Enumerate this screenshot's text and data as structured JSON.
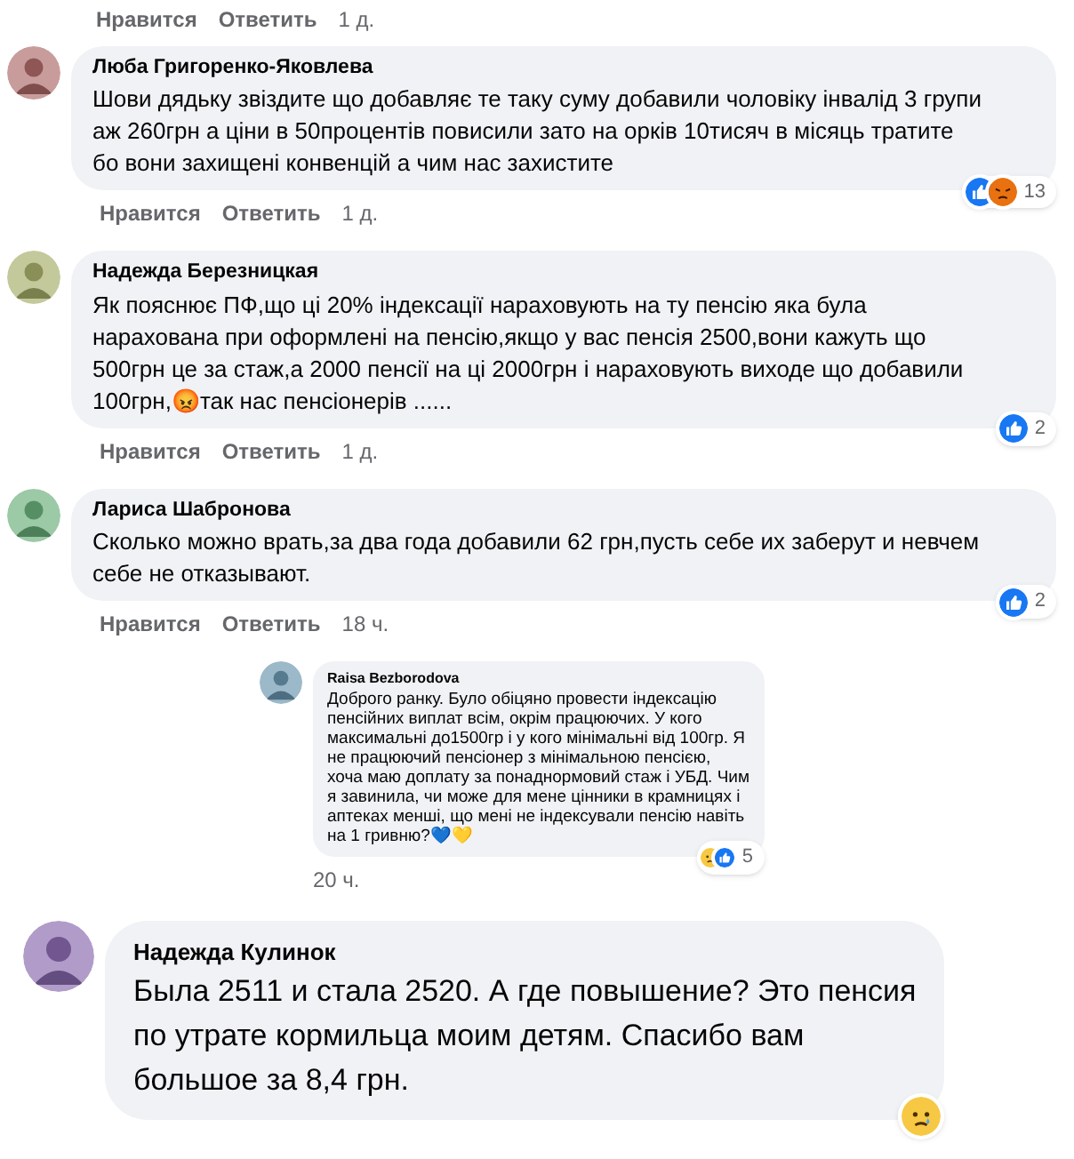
{
  "top_actions": {
    "like": "Нравится",
    "reply": "Ответить",
    "time": "1 д."
  },
  "comments": [
    {
      "kind": "normal",
      "author": "Люба Григоренко-Яковлева",
      "text": "Шови дядьку звіздите що добавляє те таку суму добавили чоловіку інвалід 3 групи\nаж 260грн а ціни в 50процентів повисили зато на орків 10тисяч в місяць тратите\nбо вони захищені конвенцій а чим нас захистите",
      "reactions": [
        {
          "kind": "like"
        },
        {
          "kind": "angry"
        }
      ],
      "count": "13",
      "like": "Нравится",
      "reply": "Ответить",
      "time": "1 д."
    },
    {
      "kind": "normal",
      "author": "Надежда Березницкая",
      "text": "Як пояснює ПФ,що ці 20% індексації нараховують на ту пенсію яка була\nнарахована при оформлені на пенсію,якщо у вас пенсія 2500,вони кажуть що\n500грн це за стаж,а 2000 пенсії на ці 2000грн і нараховують виходе що добавили\n100грн,😡так нас пенсіонерів ......",
      "reactions": [
        {
          "kind": "like"
        }
      ],
      "count": "2",
      "like": "Нравится",
      "reply": "Ответить",
      "time": "1 д."
    },
    {
      "kind": "normal",
      "author": "Лариса Шабронова",
      "text": "Сколько можно врать,за два года добавили 62 грн,пусть себе их заберут и невчем\nсебе не отказывают.",
      "reactions": [
        {
          "kind": "like"
        }
      ],
      "count": "2",
      "like": "Нравится",
      "reply": "Ответить",
      "time": "18 ч."
    },
    {
      "kind": "small",
      "author": "Raisa Bezborodova",
      "text": "Доброго ранку. Було обіцяно провести індексацію\nпенсійних виплат всім, окрім працюючих. У кого\nмаксимальні до1500гр і у кого мінімальні від 100гр. Я\nне працюючий пенсіонер з мінімальною пенсією,\nхоча маю доплату за понаднормовий стаж і УБД. Чим\nя завинила, чи може для мене цінники в крамницях і\nаптеках менші, що мені не індексували пенсію навіть\nна 1 гривню?💙💛",
      "reactions": [
        {
          "kind": "sad"
        },
        {
          "kind": "like"
        }
      ],
      "count": "5",
      "time": "20 ч."
    },
    {
      "kind": "large",
      "author": "Надежда Кулинок",
      "text": "Была 2511 и стала 2520. А где повышение? Это пенсия\nпо утрате кормильца моим детям. Спасибо вам\nбольшое за 8,4 грн.",
      "reactions": [
        {
          "kind": "sad"
        }
      ]
    }
  ]
}
